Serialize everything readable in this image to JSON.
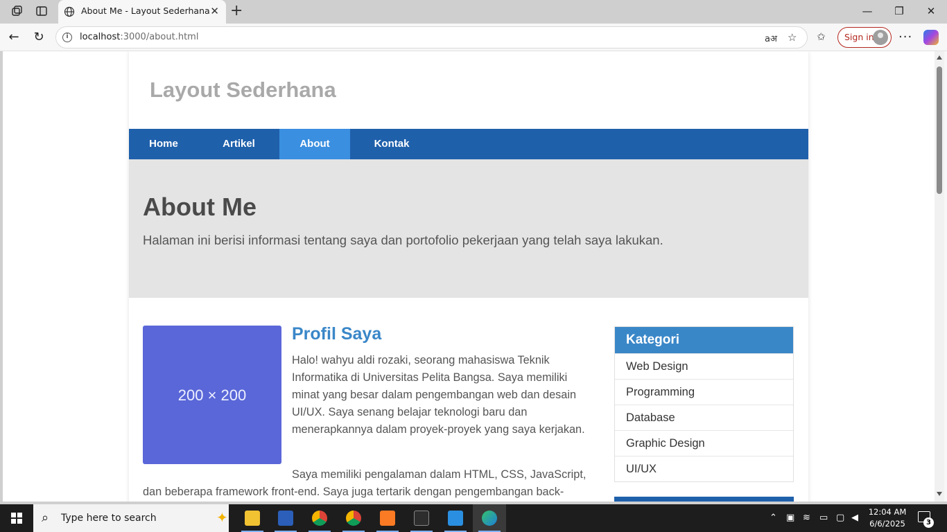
{
  "browser": {
    "tab_title": "About Me - Layout Sederhana",
    "url_host": "localhost",
    "url_rest": ":3000/about.html",
    "sign_in_label": "Sign in",
    "read_aloud_glyph": "aअ",
    "more_glyph": "···"
  },
  "site": {
    "title": "Layout Sederhana",
    "nav": [
      {
        "label": "Home",
        "active": false
      },
      {
        "label": "Artikel",
        "active": false
      },
      {
        "label": "About",
        "active": true
      },
      {
        "label": "Kontak",
        "active": false
      }
    ],
    "accent_color": "#1f60ab",
    "active_nav_color": "#3a8fe0"
  },
  "hero": {
    "title": "About Me",
    "subtitle": "Halaman ini berisi informasi tentang saya dan portofolio pekerjaan yang telah saya lakukan."
  },
  "article": {
    "image_label": "200 × 200",
    "title": "Profil Saya",
    "paragraph_1": "Halo! wahyu aldi rozaki, seorang mahasiswa Teknik Informatika di Universitas Pelita Bangsa. Saya memiliki minat yang besar dalam pengembangan web dan desain UI/UX. Saya senang belajar teknologi baru dan menerapkannya dalam proyek-proyek yang saya kerjakan.",
    "paragraph_2": "Saya memiliki pengalaman dalam HTML, CSS, JavaScript, dan beberapa framework front-end. Saya juga tertarik dengan pengembangan back-"
  },
  "sidebar": {
    "heading": "Kategori",
    "items": [
      "Web Design",
      "Programming",
      "Database",
      "Graphic Design",
      "UI/UX"
    ]
  },
  "taskbar": {
    "search_placeholder": "Type here to search",
    "time": "12:04 AM",
    "date": "6/6/2025",
    "notification_count": "3"
  }
}
